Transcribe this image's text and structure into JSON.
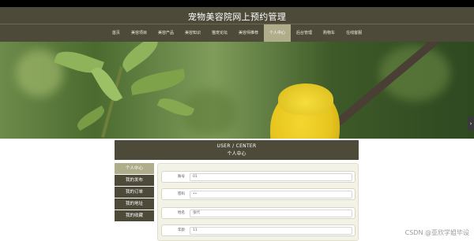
{
  "header": {
    "title": "宠物美容院网上预约管理"
  },
  "nav": {
    "items": [
      "首页",
      "美容项目",
      "美容产品",
      "美容知识",
      "猫宠论坛",
      "美容师推荐",
      "个人中心",
      "后台管理",
      "购物车",
      "在线客服"
    ],
    "active_index": 6
  },
  "banner": {
    "loading_glyph": "⁂",
    "next_arrow": "›",
    "slides": 3,
    "active_slide": 1
  },
  "center": {
    "title_en": "USER / CENTER",
    "title_cn": "个人中心"
  },
  "sidebar": {
    "items": [
      "个人中心",
      "我的发布",
      "我的订单",
      "我的地址",
      "我的收藏"
    ],
    "active_index": 0
  },
  "form": {
    "fields": [
      {
        "label": "账号",
        "value": "01"
      },
      {
        "label": "密码",
        "value": "••"
      },
      {
        "label": "姓名",
        "value": "张代"
      },
      {
        "label": "年龄",
        "value": "11"
      }
    ]
  },
  "watermark": "CSDN @亚欣学姐毕设",
  "colors": {
    "primary": "#4d4a3a",
    "active": "#b0ae8a"
  }
}
